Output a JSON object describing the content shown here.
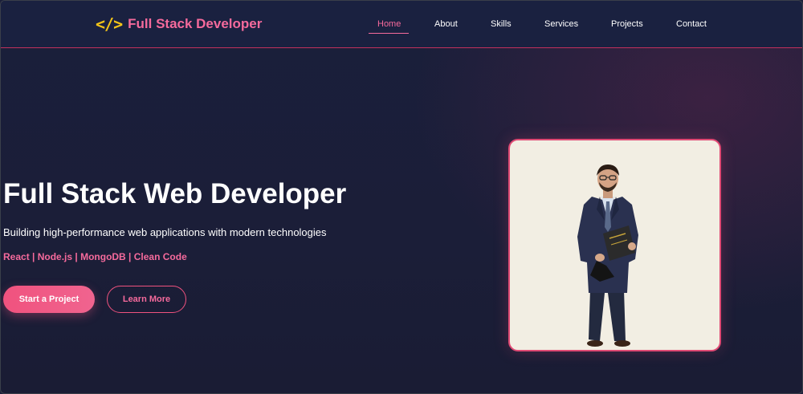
{
  "navbar": {
    "logo_icon": "</>",
    "logo_text": "Full Stack Developer",
    "links": [
      {
        "label": "Home",
        "active": true
      },
      {
        "label": "About",
        "active": false
      },
      {
        "label": "Skills",
        "active": false
      },
      {
        "label": "Services",
        "active": false
      },
      {
        "label": "Projects",
        "active": false
      },
      {
        "label": "Contact",
        "active": false
      }
    ]
  },
  "hero": {
    "title": "Full Stack Web Developer",
    "subtitle": "Building high-performance web applications with modern technologies",
    "tech_stack": "React | Node.js | MongoDB | Clean Code",
    "primary_button": "Start a Project",
    "secondary_button": "Learn More"
  },
  "colors": {
    "background": "#1b1f3a",
    "navbar": "#1a2140",
    "accent_pink": "#f56a9c",
    "button_pink": "#f0527e",
    "logo_icon_yellow": "#f5c518",
    "photo_background": "#f2eee3"
  },
  "icons": {
    "logo": "code-brackets-icon"
  }
}
